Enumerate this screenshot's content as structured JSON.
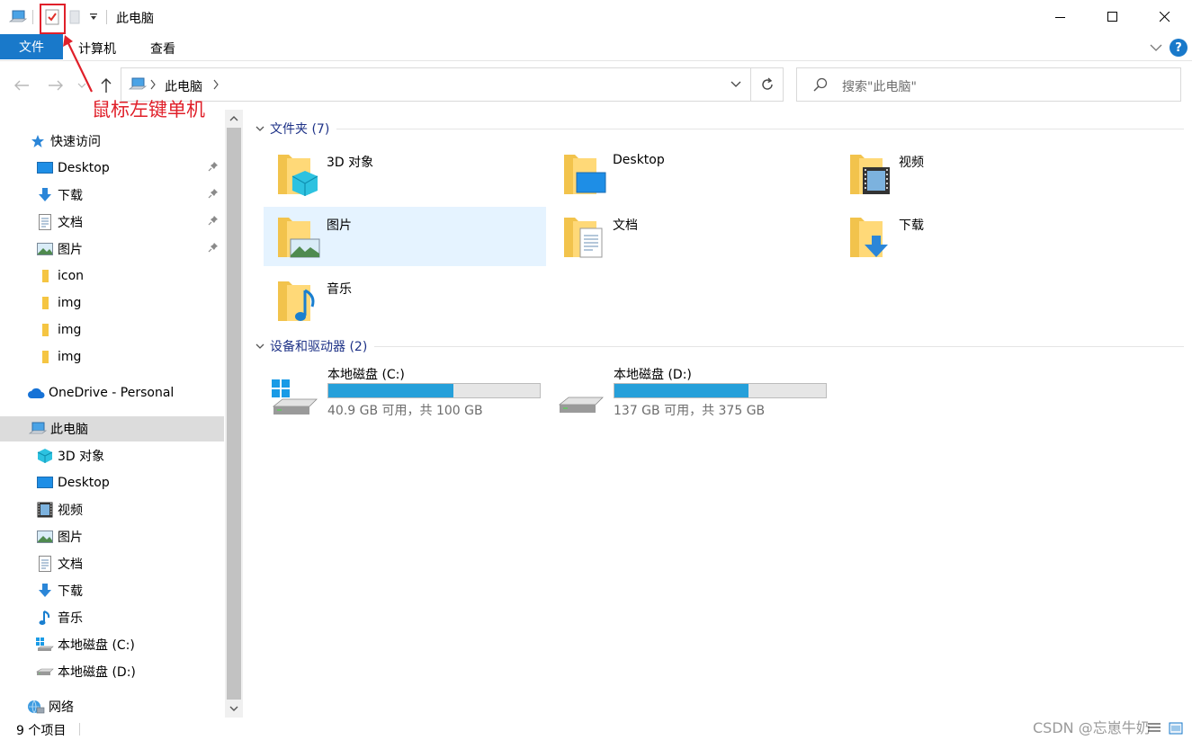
{
  "window": {
    "title": "此电脑",
    "minimize_icon": "minimize-icon",
    "maximize_icon": "maximize-icon",
    "close_icon": "close-icon"
  },
  "ribbon": {
    "file_tab": "文件",
    "tabs": [
      "计算机",
      "查看"
    ],
    "help_label": "?"
  },
  "address": {
    "location": "此电脑",
    "separator": ">"
  },
  "search": {
    "placeholder": "搜索\"此电脑\""
  },
  "annotation": {
    "text": "鼠标左键单机",
    "color": "#e0202a"
  },
  "sidebar": {
    "quick_access": {
      "label": "快速访问",
      "items": [
        {
          "label": "Desktop",
          "icon": "desktop-icon",
          "pinned": true
        },
        {
          "label": "下载",
          "icon": "download-icon",
          "pinned": true
        },
        {
          "label": "文档",
          "icon": "document-icon",
          "pinned": true
        },
        {
          "label": "图片",
          "icon": "picture-icon",
          "pinned": true
        },
        {
          "label": "icon",
          "icon": "folder-icon",
          "pinned": false
        },
        {
          "label": "img",
          "icon": "folder-icon",
          "pinned": false
        },
        {
          "label": "img",
          "icon": "folder-icon",
          "pinned": false
        },
        {
          "label": "img",
          "icon": "folder-icon",
          "pinned": false
        }
      ]
    },
    "onedrive": {
      "label": "OneDrive - Personal"
    },
    "this_pc": {
      "label": "此电脑",
      "items": [
        {
          "label": "3D 对象",
          "icon": "cube-icon"
        },
        {
          "label": "Desktop",
          "icon": "desktop-icon"
        },
        {
          "label": "视频",
          "icon": "video-icon"
        },
        {
          "label": "图片",
          "icon": "picture-icon"
        },
        {
          "label": "文档",
          "icon": "document-icon"
        },
        {
          "label": "下载",
          "icon": "download-icon"
        },
        {
          "label": "音乐",
          "icon": "music-icon"
        },
        {
          "label": "本地磁盘 (C:)",
          "icon": "windows-drive-icon"
        },
        {
          "label": "本地磁盘 (D:)",
          "icon": "drive-icon"
        }
      ]
    },
    "network": {
      "label": "网络"
    }
  },
  "main": {
    "folders_group": {
      "label": "文件夹 (7)",
      "items": [
        {
          "label": "3D 对象",
          "icon": "cube-folder-icon"
        },
        {
          "label": "Desktop",
          "icon": "desktop-folder-icon"
        },
        {
          "label": "视频",
          "icon": "video-folder-icon"
        },
        {
          "label": "图片",
          "icon": "picture-folder-icon",
          "selected": true
        },
        {
          "label": "文档",
          "icon": "document-folder-icon"
        },
        {
          "label": "下载",
          "icon": "download-folder-icon"
        },
        {
          "label": "音乐",
          "icon": "music-folder-icon"
        }
      ]
    },
    "drives_group": {
      "label": "设备和驱动器 (2)",
      "items": [
        {
          "label": "本地磁盘 (C:)",
          "detail": "40.9 GB 可用，共 100 GB",
          "used_fraction": 0.591
        },
        {
          "label": "本地磁盘 (D:)",
          "detail": "137 GB 可用，共 375 GB",
          "used_fraction": 0.635
        }
      ]
    }
  },
  "status": {
    "item_count": "9 个项目"
  },
  "watermark": "CSDN @忘崽牛奶",
  "colors": {
    "accent": "#1979ca",
    "selection": "#e5f3ff",
    "drive_bar": "#26a0da",
    "group_header": "#1e3287"
  }
}
